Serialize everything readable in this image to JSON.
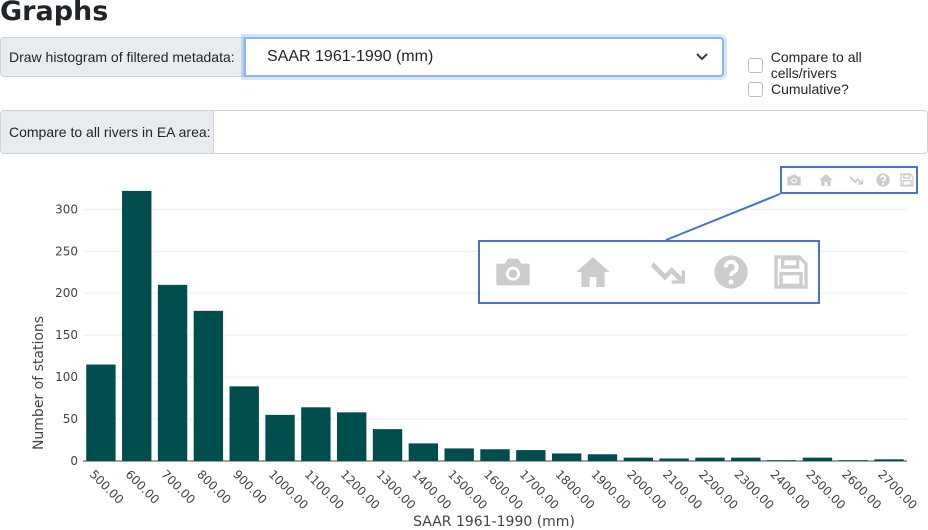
{
  "page": {
    "title": "Graphs"
  },
  "controls": {
    "histogram_label": "Draw histogram of filtered metadata:",
    "histogram_value": "SAAR 1961-1990 (mm)",
    "compare_all_label": "Compare to all cells/rivers",
    "cumulative_label": "Cumulative?",
    "compare_rivers_label": "Compare to all rivers in EA area:",
    "compare_rivers_value": ""
  },
  "modebar": {
    "icons": [
      "camera-icon",
      "home-icon",
      "autoscale-icon",
      "help-icon",
      "save-icon"
    ],
    "color": "#cccccc",
    "highlight_color": "#4a72c8"
  },
  "chart_data": {
    "type": "bar",
    "xlabel": "SAAR 1961-1990 (mm)",
    "ylabel": "Number of stations",
    "categories": [
      "500.00",
      "600.00",
      "700.00",
      "800.00",
      "900.00",
      "1000.00",
      "1100.00",
      "1200.00",
      "1300.00",
      "1400.00",
      "1500.00",
      "1600.00",
      "1700.00",
      "1800.00",
      "1900.00",
      "2000.00",
      "2100.00",
      "2200.00",
      "2300.00",
      "2400.00",
      "2500.00",
      "2600.00",
      "2700.00"
    ],
    "values": [
      115,
      322,
      210,
      179,
      89,
      55,
      64,
      58,
      38,
      21,
      15,
      14,
      13,
      9,
      8,
      4,
      3,
      4,
      4,
      1,
      4,
      1,
      2
    ],
    "yticks": [
      0,
      50,
      100,
      150,
      200,
      250,
      300
    ],
    "ylim": [
      0,
      335
    ],
    "grid": true,
    "bar_color": "#004d4d"
  }
}
